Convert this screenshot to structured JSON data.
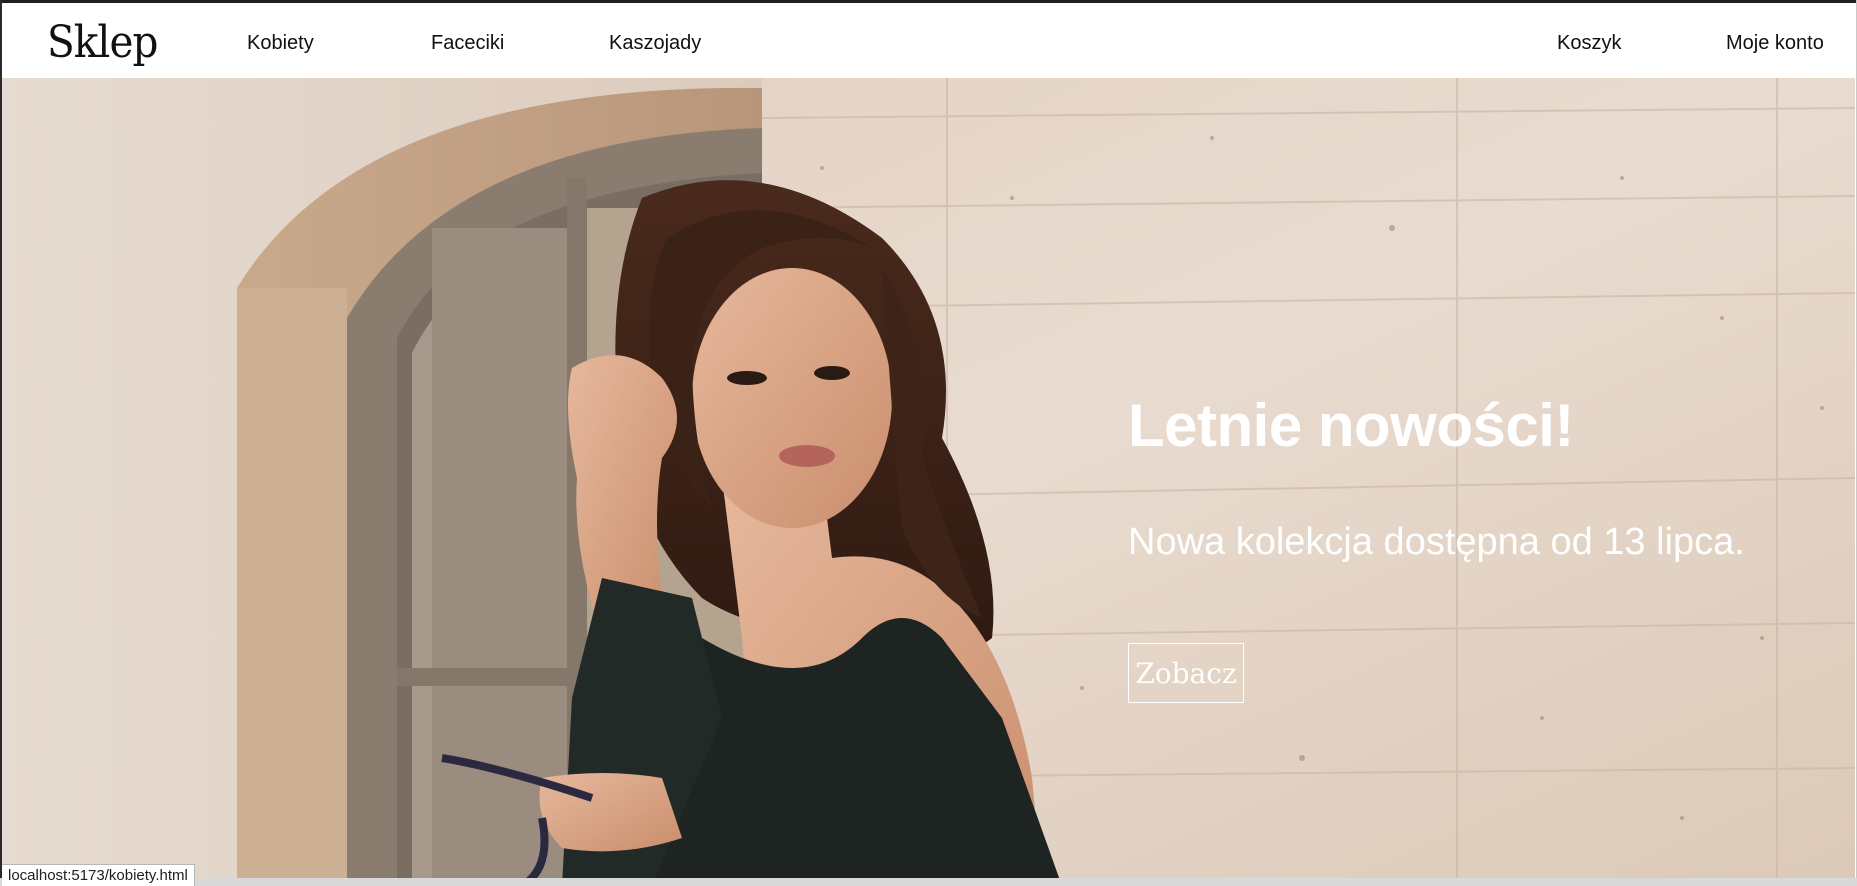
{
  "header": {
    "logo": "Sklep",
    "nav_left": [
      "Kobiety",
      "Faceciki",
      "Kaszojady"
    ],
    "nav_right": [
      "Koszyk",
      "Moje konto"
    ]
  },
  "hero": {
    "title": "Letnie nowości!",
    "subtitle": "Nowa kolekcja dostępna od 13 lipca.",
    "button_label": "Zobacz",
    "image_description_icon": "hero-photo"
  },
  "status_bar": {
    "url": "localhost:5173/kobiety.html"
  },
  "colors": {
    "header_bg": "#ffffff",
    "text_dark": "#111111",
    "hero_text": "#ffffff",
    "wall": "#e3d4c6"
  }
}
